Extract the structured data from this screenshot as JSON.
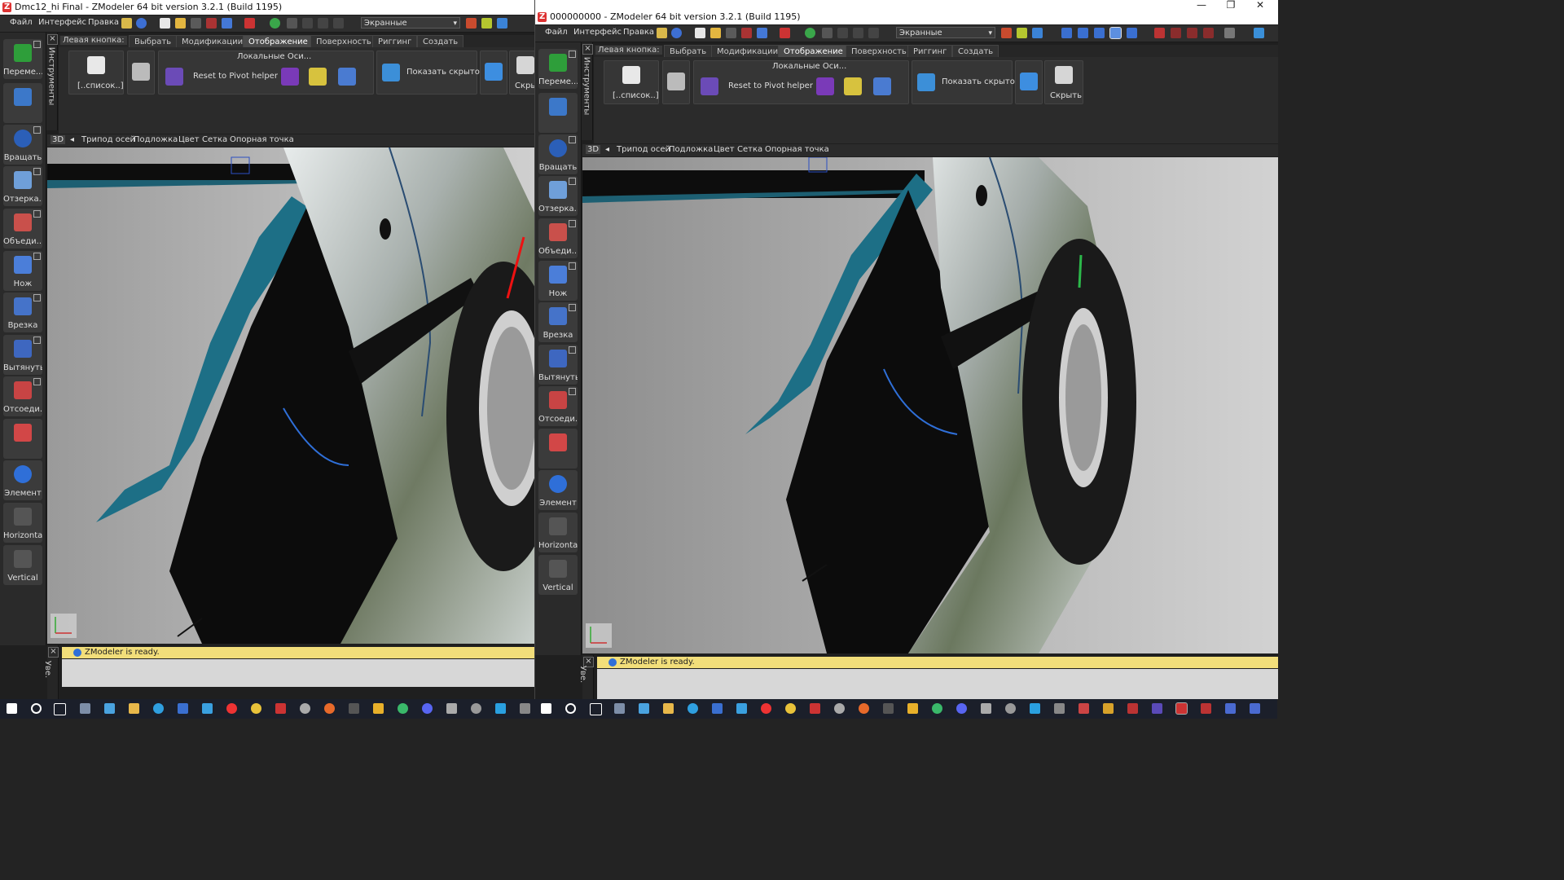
{
  "windows": [
    {
      "title": "Dmc12_hi Final - ZModeler 64 bit version 3.2.1 (Build 1195)",
      "menu": [
        "Файл",
        "Интерфейс",
        "Правка"
      ],
      "view_dropdown": "Экранные",
      "left_button_label": "Левая кнопка:",
      "tabs": [
        "Выбрать",
        "Модификации",
        "Отображение",
        "Поверхность",
        "Риггинг",
        "Создать"
      ],
      "active_tab": "Отображение",
      "ribbon": {
        "list_button": "[..список..]",
        "local_axes_group": "Локальные Оси...",
        "reset_pivot": "Reset to Pivot helper",
        "show_hidden": "Показать скрытое",
        "hide": "Скры"
      },
      "tools": [
        "Переме...",
        "",
        "Вращать",
        "Отзерка...",
        "Объеди...",
        "Нож",
        "Врезка",
        "Вытянуть",
        "Отсоеди...",
        "",
        "Элемент",
        "Horizontal",
        "Vertical"
      ],
      "side_strip_label": "Инструменты",
      "viewport_bar": [
        "3D",
        "Трипод осей",
        "Подложка",
        "Цвет",
        "Сетка",
        "Опорная точка"
      ],
      "status": "ZModeler is ready.",
      "bottom_strip_label": "Уве."
    },
    {
      "title": "000000000 - ZModeler 64 bit version 3.2.1 (Build 1195)",
      "menu": [
        "Файл",
        "Интерфейс",
        "Правка"
      ],
      "view_dropdown": "Экранные",
      "left_button_label": "Левая кнопка:",
      "tabs": [
        "Выбрать",
        "Модификации",
        "Отображение",
        "Поверхность",
        "Риггинг",
        "Создать"
      ],
      "active_tab": "Отображение",
      "ribbon": {
        "list_button": "[..список..]",
        "local_axes_group": "Локальные Оси...",
        "reset_pivot": "Reset to Pivot helper",
        "show_hidden": "Показать скрытое",
        "hide": "Скрыть"
      },
      "tools": [
        "Переме...",
        "",
        "Вращать",
        "Отзерка...",
        "Объеди...",
        "Нож",
        "Врезка",
        "Вытянуть",
        "Отсоеди...",
        "",
        "Элемент",
        "Horizontal",
        "Vertical"
      ],
      "side_strip_label": "Инструменты",
      "viewport_bar": [
        "3D",
        "Трипод осей",
        "Подложка",
        "Цвет",
        "Сетка",
        "Опорная точка"
      ],
      "status": "ZModeler is ready.",
      "bottom_strip_label": "Уве."
    }
  ],
  "window_controls": {
    "minimize": "—",
    "restore": "❐",
    "close": "✕"
  },
  "colors": {
    "accent": "#f2de7a",
    "fender_teal": "#1d6f86",
    "tool_bg": "#3b3b3b"
  }
}
